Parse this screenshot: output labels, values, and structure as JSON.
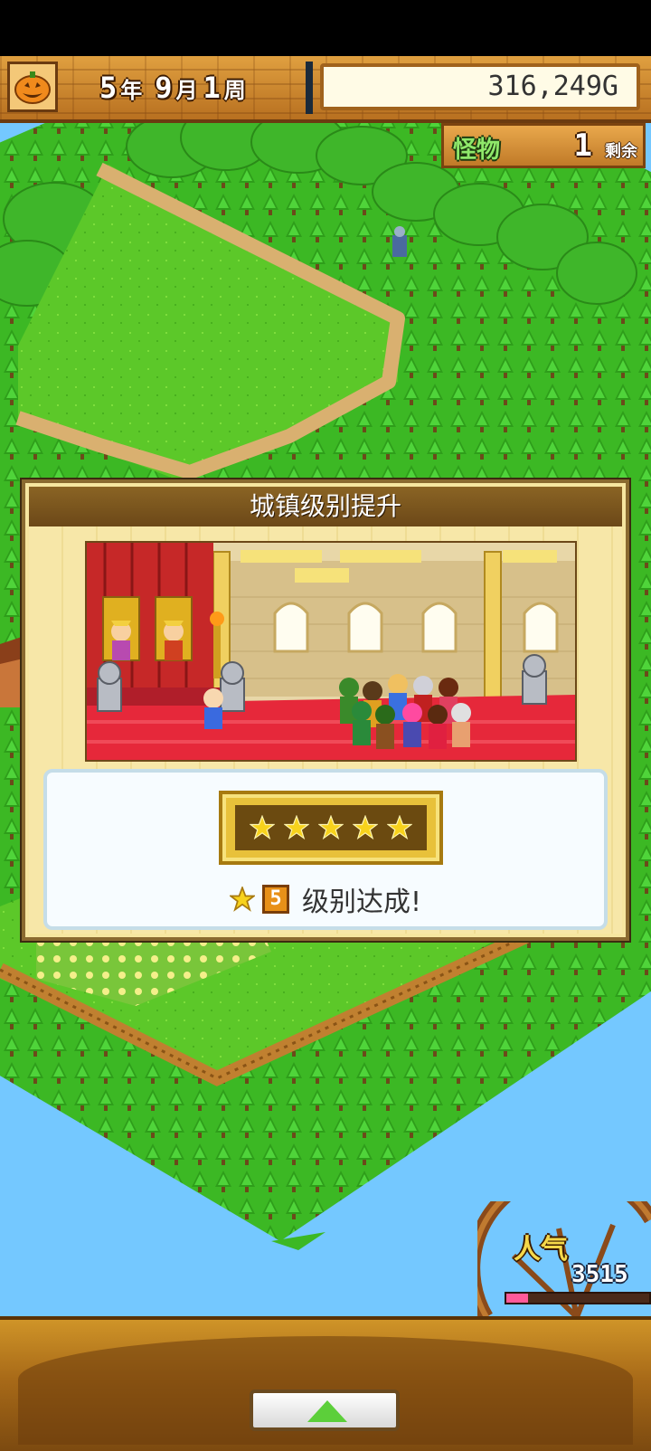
{
  "hud": {
    "year_num": "5",
    "year_unit": "年",
    "month_num": "9",
    "month_unit": "月",
    "week_num": "1",
    "week_unit": "周",
    "gold": "316,249G",
    "pumpkin_icon": "pumpkin-icon"
  },
  "monster": {
    "label": "怪物",
    "count": "1",
    "suffix": "剩余"
  },
  "dialog": {
    "title": "城镇级别提升",
    "stars": 5,
    "level": "5",
    "achieve_text": "级别达成!"
  },
  "popularity": {
    "label": "人气",
    "value": "3515",
    "fill_fraction": 0.15
  },
  "colors": {
    "grass": "#5cc829",
    "water": "#74c8ff",
    "wood": "#c88a30",
    "star": "#f7d21c"
  }
}
